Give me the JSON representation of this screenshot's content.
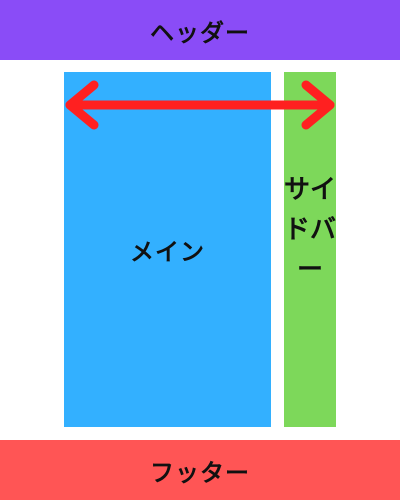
{
  "header": {
    "label": "ヘッダー"
  },
  "main": {
    "label": "メイン"
  },
  "sidebar": {
    "label": "サイドバー"
  },
  "footer": {
    "label": "フッター"
  },
  "colors": {
    "header": "#8a4cf7",
    "main": "#33b0ff",
    "sidebar": "#7dd85a",
    "footer": "#ff5555",
    "arrow": "#ff2020"
  }
}
